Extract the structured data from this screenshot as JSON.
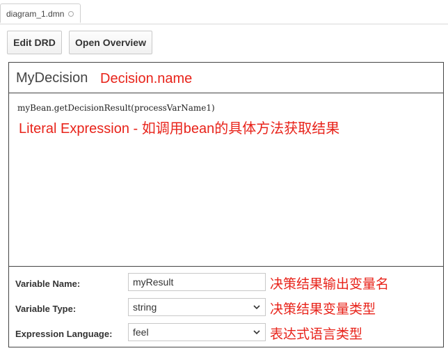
{
  "tab": {
    "label": "diagram_1.dmn"
  },
  "toolbar": {
    "edit_drd_label": "Edit DRD",
    "open_overview_label": "Open Overview"
  },
  "decision": {
    "name": "MyDecision",
    "name_annotation": "Decision.name",
    "literal_expression": "myBean.getDecisionResult(processVarName1)",
    "literal_annotation": "Literal Expression - 如调用bean的具体方法获取结果"
  },
  "properties": {
    "variable_name": {
      "label": "Variable Name:",
      "value": "myResult",
      "annotation": "决策结果输出变量名"
    },
    "variable_type": {
      "label": "Variable Type:",
      "value": "string",
      "annotation": "决策结果变量类型"
    },
    "expression_language": {
      "label": "Expression Language:",
      "value": "feel",
      "annotation": "表达式语言类型"
    }
  },
  "colors": {
    "annotation": "#e8231a",
    "border": "#444444"
  },
  "icons": {
    "tab_status": "circle-icon",
    "select_arrow": "chevron-down-icon"
  }
}
